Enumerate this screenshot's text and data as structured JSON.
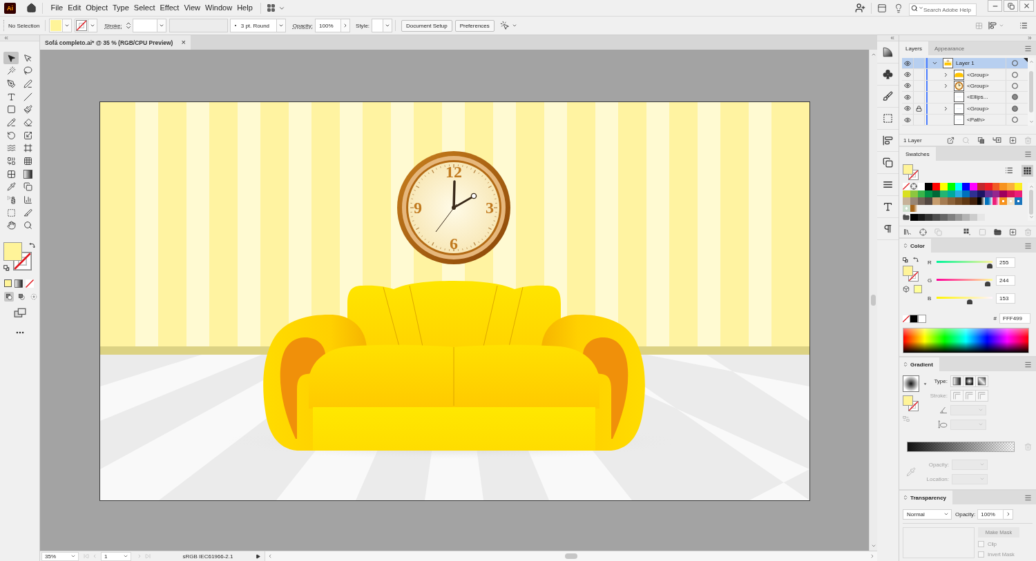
{
  "app_bar": {
    "logo": "Ai",
    "menu": [
      "File",
      "Edit",
      "Object",
      "Type",
      "Select",
      "Effect",
      "View",
      "Window",
      "Help"
    ],
    "search": {
      "placeholder": "Search Adobe Help"
    }
  },
  "control_bar": {
    "selection": "No Selection",
    "fill_swatch": {
      "color": "#fff499"
    },
    "stroke_label": "Stroke:",
    "brush": "3 pt. Round",
    "opacity_label": "Opacity:",
    "opacity": "100%",
    "style_label": "Style:",
    "buttons": [
      "Document Setup",
      "Preferences"
    ]
  },
  "toolbar": {
    "tools": [
      {
        "selected": true
      },
      {
        "selected": false
      },
      {
        "selected": false
      },
      {
        "selected": false
      },
      {
        "selected": false
      },
      {
        "selected": false
      },
      {
        "selected": false
      },
      {
        "selected": false
      },
      {
        "selected": false
      },
      {
        "selected": false
      },
      {
        "selected": false
      },
      {
        "selected": false
      },
      {
        "selected": false
      },
      {
        "selected": false
      },
      {
        "selected": false
      },
      {
        "selected": false
      },
      {
        "selected": false
      },
      {
        "selected": false
      },
      {
        "selected": false
      },
      {
        "selected": false
      },
      {
        "selected": false
      },
      {
        "selected": false
      },
      {
        "selected": false
      },
      {
        "selected": false
      },
      {
        "selected": false
      },
      {
        "selected": false
      },
      {
        "selected": false
      },
      {
        "selected": false
      }
    ],
    "fill_swatch": {
      "color": "#fff499"
    },
    "draw_modes": [
      {
        "selected": true
      },
      {
        "selected": false
      },
      {
        "selected": false
      }
    ]
  },
  "document_tab": {
    "title": "Sofá completo.ai* @ 35 % (RGB/CPU Preview)",
    "close": "×"
  },
  "artboard": {
    "clock_numerals": [
      "12",
      "3",
      "6",
      "9"
    ]
  },
  "status_bar": {
    "zoom": "35%",
    "artboard": "1",
    "color_profile": "sRGB IEC61966-2.1"
  },
  "layers_panel": {
    "tabs": [
      {
        "label": "Layers",
        "selected": true
      },
      {
        "label": "Appearance",
        "selected": false
      }
    ],
    "layers": [
      {
        "name": "Layer 1",
        "kind": "layer",
        "color": "#4a7cff",
        "visible": true,
        "locked": false,
        "expanded": true,
        "selected": true,
        "has_appearance": false,
        "children": [
          {
            "name": "<Group>",
            "kind": "group",
            "visible": true,
            "locked": false,
            "expanded": false,
            "selected": false,
            "has_appearance": false
          },
          {
            "name": "<Group>",
            "kind": "group",
            "visible": true,
            "locked": false,
            "expanded": false,
            "selected": false,
            "has_appearance": false
          },
          {
            "name": "<Ellips...",
            "kind": "path",
            "visible": true,
            "locked": false,
            "selected": false,
            "has_appearance": true
          },
          {
            "name": "<Group>",
            "kind": "group",
            "visible": true,
            "locked": true,
            "expanded": false,
            "selected": false,
            "has_appearance": true
          },
          {
            "name": "<Path>",
            "kind": "path",
            "visible": true,
            "locked": false,
            "selected": false,
            "has_appearance": false
          }
        ]
      }
    ],
    "count": "1 Layer"
  },
  "swatches_panel": {
    "title": "Swatches",
    "fill_swatch": {
      "color": "#fff499"
    },
    "views": [
      {
        "selected": false
      },
      {
        "selected": true
      }
    ],
    "rows": [
      [
        {
          "kind": "none"
        },
        {
          "kind": "registration"
        },
        {
          "kind": "color",
          "color": "#ffffff"
        },
        {
          "kind": "color",
          "color": "#000000"
        },
        {
          "kind": "color",
          "color": "#ff0000"
        },
        {
          "kind": "color",
          "color": "#ffff00"
        },
        {
          "kind": "color",
          "color": "#00ff00"
        },
        {
          "kind": "color",
          "color": "#00ffff"
        },
        {
          "kind": "color",
          "color": "#0000ff"
        },
        {
          "kind": "color",
          "color": "#ff00ff"
        },
        {
          "kind": "color",
          "color": "#c1272d"
        },
        {
          "kind": "color",
          "color": "#ed1c24"
        },
        {
          "kind": "color",
          "color": "#f15a24"
        },
        {
          "kind": "color",
          "color": "#f7931e"
        },
        {
          "kind": "color",
          "color": "#fbb03b"
        },
        {
          "kind": "color",
          "color": "#fcee21"
        }
      ],
      [
        {
          "kind": "color",
          "color": "#d9e021"
        },
        {
          "kind": "color",
          "color": "#8cc63f"
        },
        {
          "kind": "color",
          "color": "#39b54a"
        },
        {
          "kind": "color",
          "color": "#009245"
        },
        {
          "kind": "color",
          "color": "#006837"
        },
        {
          "kind": "color",
          "color": "#22b573"
        },
        {
          "kind": "color",
          "color": "#00a99d"
        },
        {
          "kind": "color",
          "color": "#29abe2"
        },
        {
          "kind": "color",
          "color": "#0071bc"
        },
        {
          "kind": "color",
          "color": "#2e3192"
        },
        {
          "kind": "color",
          "color": "#1b1464"
        },
        {
          "kind": "color",
          "color": "#662d91"
        },
        {
          "kind": "color",
          "color": "#93278f"
        },
        {
          "kind": "color",
          "color": "#9e005d"
        },
        {
          "kind": "color",
          "color": "#d4145a"
        },
        {
          "kind": "color",
          "color": "#ed1e79"
        }
      ],
      [
        {
          "kind": "color",
          "color": "#c7b299"
        },
        {
          "kind": "color",
          "color": "#998675"
        },
        {
          "kind": "color",
          "color": "#736357"
        },
        {
          "kind": "color",
          "color": "#534741"
        },
        {
          "kind": "color",
          "color": "#c69c6d"
        },
        {
          "kind": "color",
          "color": "#a67c52"
        },
        {
          "kind": "color",
          "color": "#8c6239"
        },
        {
          "kind": "color",
          "color": "#754c24"
        },
        {
          "kind": "color",
          "color": "#603813"
        },
        {
          "kind": "color",
          "color": "#42210b"
        },
        {
          "kind": "gradient",
          "color": "#000000"
        },
        {
          "kind": "gradient",
          "color": "#0071bc"
        },
        {
          "kind": "gradient",
          "color": "#ed1e79"
        },
        {
          "kind": "pattern",
          "color": "#f7931e"
        },
        {
          "kind": "pattern",
          "color": "#f2e3c6"
        },
        {
          "kind": "pattern",
          "color": "#1b75bc"
        }
      ],
      [
        {
          "kind": "pattern",
          "color": "#cfe0cf"
        },
        {
          "kind": "gradient",
          "color": "#a6651a"
        }
      ],
      [
        {
          "kind": "folder"
        },
        {
          "kind": "color",
          "color": "#000000"
        },
        {
          "kind": "color",
          "color": "#1a1a1a"
        },
        {
          "kind": "color",
          "color": "#333333"
        },
        {
          "kind": "color",
          "color": "#4d4d4d"
        },
        {
          "kind": "color",
          "color": "#666666"
        },
        {
          "kind": "color",
          "color": "#808080"
        },
        {
          "kind": "color",
          "color": "#999999"
        },
        {
          "kind": "color",
          "color": "#b3b3b3"
        },
        {
          "kind": "color",
          "color": "#cccccc"
        },
        {
          "kind": "color",
          "color": "#e6e6e6"
        }
      ]
    ]
  },
  "color_panel": {
    "title": "Color",
    "fill_swatch": {
      "color": "#fff499"
    },
    "web_swatch": {
      "color": "#ffff99"
    },
    "channels": [
      {
        "label": "R",
        "level": 1,
        "value": "255"
      },
      {
        "label": "G",
        "level": 0.957,
        "value": "244"
      },
      {
        "label": "B",
        "level": 0.6,
        "value": "153"
      }
    ],
    "hex_label": "#",
    "hex": "FFF499"
  },
  "gradient_panel": {
    "title": "Gradient",
    "fill_swatch": {
      "color": "#fff499"
    },
    "type_label": "Type:",
    "stroke": {
      "label": "Stroke:",
      "disabled": true
    },
    "opacity": {
      "label": "Opacity:",
      "disabled": true
    },
    "location": {
      "label": "Location:",
      "disabled": true
    }
  },
  "transparency_panel": {
    "title": "Transparency",
    "blend_mode": "Normal",
    "opacity_label": "Opacity:",
    "opacity": "100%",
    "make_mask": {
      "label": "Make Mask",
      "disabled": true
    },
    "options": [
      {
        "label": "Clip",
        "checked": false,
        "disabled": true
      },
      {
        "label": "Invert Mask",
        "checked": false,
        "disabled": true
      }
    ]
  }
}
